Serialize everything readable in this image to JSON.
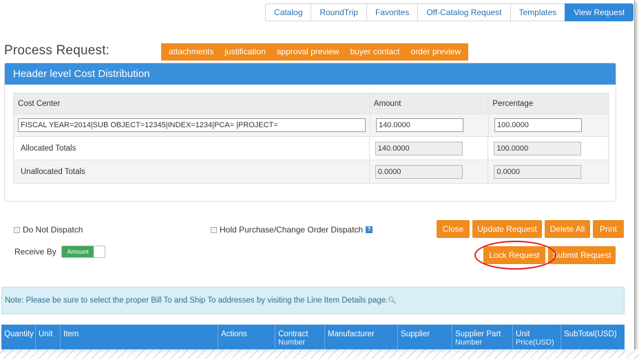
{
  "tabs": [
    "Catalog",
    "RoundTrip",
    "Favorites",
    "Off-Catalog Request",
    "Templates",
    "View Request"
  ],
  "page_title": "Process Request:",
  "sections": [
    "attachments",
    "justification",
    "approval preview",
    "buyer contact",
    "order preview"
  ],
  "cost_panel": {
    "title": "Header level Cost Distribution",
    "columns": [
      "Cost Center",
      "Amount",
      "Percentage"
    ],
    "row": {
      "cost_center": "FISCAL YEAR=2014|SUB OBJECT=12345|INDEX=1234|PCA= |PROJECT=",
      "amount": "140.0000",
      "percentage": "100.0000"
    },
    "allocated": {
      "label": "Allocated Totals",
      "amount": "140.0000",
      "percentage": "100.0000"
    },
    "unallocated": {
      "label": "Unallocated Totals",
      "amount": "0.0000",
      "percentage": "0.0000"
    }
  },
  "options": {
    "do_not_dispatch": "Do Not Dispatch",
    "hold_dispatch": "Hold Purchase/Change Order Dispatch",
    "help_glyph": "?",
    "receive_by": "Receive By",
    "receive_toggle": "Amount"
  },
  "actions": {
    "close": "Close",
    "update": "Update Request",
    "delete_all": "Delete All",
    "print": "Print",
    "lock": "Lock Request",
    "submit": "Submit Request"
  },
  "note": "Note: Please be sure to select the proper Bill To and Ship To addresses by visiting the Line Item Details page.",
  "line_columns": [
    "Quantity",
    "Unit",
    "Item",
    "Actions",
    "Contract",
    "Manufacturer",
    "Supplier",
    "Supplier Part",
    "Unit",
    "SubTotal(USD)"
  ],
  "line_columns_sub": [
    "",
    "",
    "",
    "",
    "Number",
    "",
    "",
    "Number",
    "Price(USD)",
    ""
  ],
  "colors": {
    "accent_blue": "#2f88d8",
    "accent_orange": "#f08b1e",
    "toggle_green": "#3ea75a",
    "highlight_red": "#e21b1b"
  }
}
